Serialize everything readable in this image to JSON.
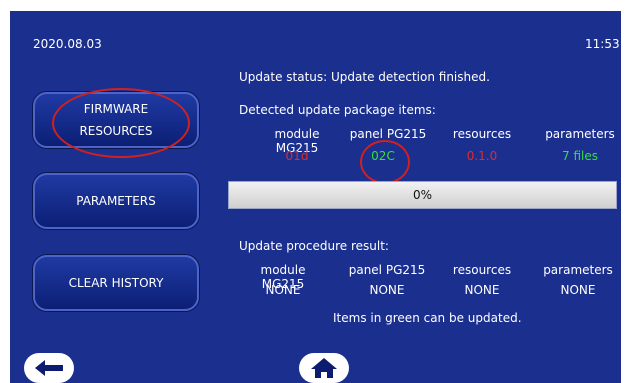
{
  "header": {
    "date": "2020.08.03",
    "time": "11:53"
  },
  "buttons": {
    "firmware_resources": "FIRMWARE RESOURCES",
    "parameters": "PARAMETERS",
    "clear_history": "CLEAR HISTORY"
  },
  "status": {
    "text": "Update status: Update detection finished."
  },
  "detected": {
    "title": "Detected update package items:",
    "columns": [
      {
        "label": "module MG215",
        "value": "01d"
      },
      {
        "label": "panel PG215",
        "value": "02C"
      },
      {
        "label": "resources",
        "value": "0.1.0"
      },
      {
        "label": "parameters",
        "value": "7 files"
      }
    ]
  },
  "progress": {
    "label": "0%",
    "value": 0
  },
  "result": {
    "title": "Update procedure result:",
    "columns": [
      {
        "label": "module MG215",
        "value": "NONE"
      },
      {
        "label": "panel PG215",
        "value": "NONE"
      },
      {
        "label": "resources",
        "value": "NONE"
      },
      {
        "label": "parameters",
        "value": "NONE"
      }
    ],
    "note": "Items in green can be updated."
  },
  "icons": {
    "back": "back-arrow-icon",
    "home": "home-icon"
  },
  "colors": {
    "background": "#1b2f8f",
    "red_value": "#e02b2b",
    "green_value": "#35e03a",
    "annotation": "#d0201f"
  }
}
